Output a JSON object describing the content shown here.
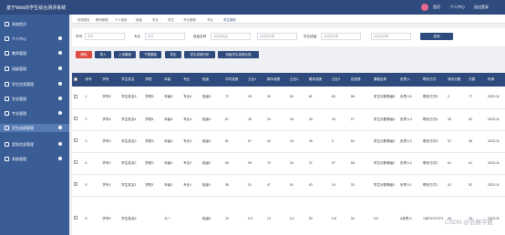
{
  "header": {
    "title": "基于Web的学生综合测评系统",
    "menu": [
      "首页",
      "个人中心",
      "退出登录"
    ]
  },
  "sidebar": {
    "items": [
      {
        "label": "系统首页",
        "active": false
      },
      {
        "label": "个人中心",
        "active": false
      },
      {
        "label": "教师管理",
        "active": false
      },
      {
        "label": "班级管理",
        "active": false
      },
      {
        "label": "学生信息管理",
        "active": false
      },
      {
        "label": "学业管理",
        "active": false
      },
      {
        "label": "专业管理",
        "active": false
      },
      {
        "label": "学生成绩管理",
        "active": true
      },
      {
        "label": "奖惩信息管理",
        "active": false
      },
      {
        "label": "系统管理",
        "active": false
      }
    ]
  },
  "breadcrumbs": [
    "系统首页",
    "教师管理",
    "个人信息",
    "班级",
    "学业",
    "学生",
    "专业管理",
    "专业",
    "学生成绩"
  ],
  "filters": {
    "student_no_label": "学号",
    "student_no_placeholder": "学号",
    "major_label": "专业",
    "major_placeholder": "专业",
    "class_label": "班级名称",
    "class_placeholder": "请选择班级",
    "extra_placeholder": "请选择学期",
    "year_label": "学业班级",
    "year_placeholder": "请选择学期",
    "year2_placeholder": "请选择学期",
    "search_label": "查询"
  },
  "actions": {
    "delete": "删除",
    "import": "导入",
    "upload": "上传模板",
    "download": "下载模板",
    "export": "导出",
    "analysis": "学生成绩分析",
    "compare": "班级学生成绩比较"
  },
  "table": {
    "headers": [
      "",
      "序号",
      "学号",
      "学生姓名",
      "学院",
      "年级",
      "专业",
      "班级",
      "平时成绩",
      "占比1",
      "期中成绩",
      "占比2",
      "期末成绩",
      "占比3",
      "总成绩",
      "课程名称",
      "负责人",
      "联系方式",
      "测评分数",
      "分数",
      "时间"
    ],
    "rows": [
      {
        "cells": [
          "",
          "1",
          "学号5",
          "学生姓名5",
          "学院5",
          "年级5",
          "专业5",
          "班级5",
          "72",
          "25",
          "30",
          "54",
          "81",
          "63",
          "56",
          "学生分数等级5",
          "负责人5",
          "联系方式5",
          "2",
          "77",
          "2023-11"
        ],
        "tall": false
      },
      {
        "cells": [
          "",
          "2",
          "学号4",
          "学生姓名4",
          "学院4",
          "年级4",
          "专业4",
          "班级4",
          "87",
          "16",
          "24",
          "18",
          "33",
          "23",
          "27",
          "学生分数等级4",
          "负责人4",
          "联系方式4",
          "42",
          "52",
          "2023-11"
        ],
        "tall": false
      },
      {
        "cells": [
          "",
          "3",
          "学号3",
          "学生姓名3",
          "学院3",
          "年级3",
          "专业3",
          "班级3",
          "51",
          "97",
          "43",
          "19",
          "39",
          "2",
          "54",
          "学生分数等级3",
          "负责人3",
          "联系方式3",
          "57",
          "45",
          "2023-11"
        ],
        "tall": false
      },
      {
        "cells": [
          "",
          "4",
          "学号2",
          "学生姓名2",
          "学院2",
          "年级2",
          "专业2",
          "班级2",
          "69",
          "99",
          "70",
          "34",
          "37",
          "57",
          "58",
          "学生分数等级2",
          "负责人2",
          "联系方式2",
          "61",
          "61",
          "2023-11"
        ],
        "tall": false
      },
      {
        "cells": [
          "",
          "5",
          "学号1",
          "学生姓名1",
          "学院1",
          "年级1",
          "专业1",
          "班级1",
          "36",
          "31",
          "47",
          "51",
          "63",
          "24",
          "33",
          "学生分数等级1",
          "负责人1",
          "联系方式1",
          "42",
          "52",
          "2023-11"
        ],
        "tall": false
      },
      {
        "cells": [
          "",
          "6",
          "学号6",
          "学生姓名6",
          "",
          "大一",
          "",
          "班级6",
          "10",
          "0.3",
          "10",
          "0.1",
          "50",
          "0.6",
          "34",
          "111",
          "A负责人",
          "13874747474",
          "44",
          "33",
          "2023-11"
        ],
        "tall": true
      }
    ]
  },
  "watermark": "CSDN @信雅学姐",
  "colors": {
    "header": "#2f4a7c",
    "sidebar": "#3a5d96",
    "delete": "#e04b3f",
    "primary": "#2f4a7c"
  }
}
